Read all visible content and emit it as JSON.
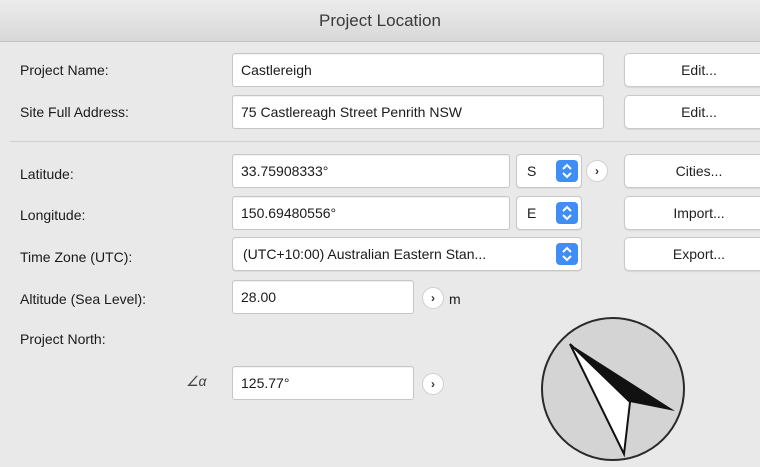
{
  "window": {
    "title": "Project Location"
  },
  "project_name": {
    "label": "Project Name:",
    "value": "Castlereigh",
    "button": "Edit..."
  },
  "site_address": {
    "label": "Site Full Address:",
    "value": "75 Castlereagh Street Penrith NSW",
    "button": "Edit..."
  },
  "latitude": {
    "label": "Latitude:",
    "value": "33.75908333°",
    "hemisphere": "S",
    "button": "Cities..."
  },
  "longitude": {
    "label": "Longitude:",
    "value": "150.69480556°",
    "hemisphere": "E",
    "button": "Import..."
  },
  "time_zone": {
    "label": "Time Zone (UTC):",
    "value": "(UTC+10:00) Australian Eastern Stan...",
    "button": "Export..."
  },
  "altitude": {
    "label": "Altitude (Sea Level):",
    "value": "28.00",
    "unit": "m"
  },
  "project_north": {
    "label": "Project North:",
    "angle_symbol": "∠α",
    "value": "125.77°"
  },
  "colors": {
    "accent": "#3f8df5",
    "background": "#e9e9e9"
  },
  "icons": [
    "arrow-right-icon",
    "stepper-icon",
    "angle-icon",
    "compass-north-icon"
  ]
}
